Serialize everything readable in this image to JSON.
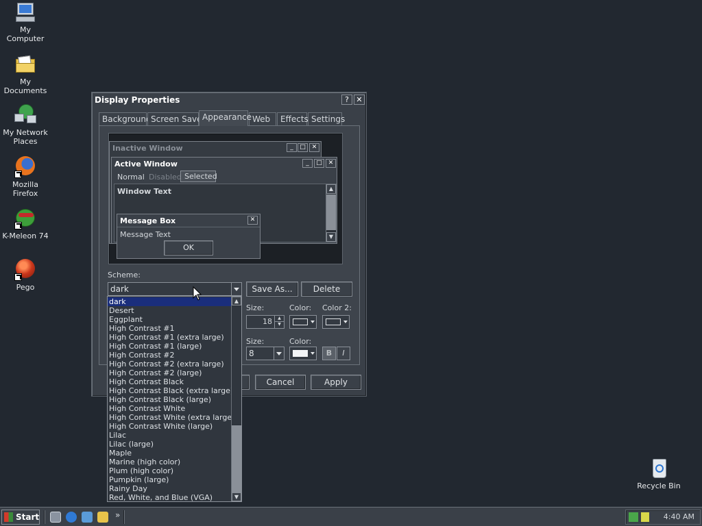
{
  "desktop": {
    "icons": [
      {
        "label": "My Computer",
        "icon": "computer-icon"
      },
      {
        "label": "My Documents",
        "icon": "folder-icon"
      },
      {
        "label": "My Network Places",
        "icon": "network-icon"
      },
      {
        "label": "Mozilla Firefox",
        "icon": "firefox-icon"
      },
      {
        "label": "K-Meleon 74",
        "icon": "k-meleon-icon"
      },
      {
        "label": "Pego",
        "icon": "pego-icon"
      },
      {
        "label": "Recycle Bin",
        "icon": "recycle-bin-icon"
      }
    ]
  },
  "window": {
    "title": "Display Properties",
    "help_label": "?",
    "close_label": "✕",
    "tabs": [
      "Background",
      "Screen Saver",
      "Appearance",
      "Web",
      "Effects",
      "Settings"
    ],
    "active_tab": "Appearance"
  },
  "preview": {
    "inactive_title": "Inactive Window",
    "active_title": "Active Window",
    "menu_normal": "Normal",
    "menu_disabled": "Disabled",
    "menu_selected": "Selected",
    "window_text": "Window Text",
    "msgbox_title": "Message Box",
    "msgbox_text": "Message Text",
    "ok_label": "OK"
  },
  "scheme": {
    "label": "Scheme:",
    "value": "dark",
    "save_as": "Save As...",
    "delete": "Delete",
    "options": [
      "dark",
      "Desert",
      "Eggplant",
      "High Contrast #1",
      "High Contrast #1 (extra large)",
      "High Contrast #1 (large)",
      "High Contrast #2",
      "High Contrast #2 (extra large)",
      "High Contrast #2 (large)",
      "High Contrast Black",
      "High Contrast Black (extra large)",
      "High Contrast Black (large)",
      "High Contrast White",
      "High Contrast White (extra large)",
      "High Contrast White (large)",
      "Lilac",
      "Lilac (large)",
      "Maple",
      "Marine (high color)",
      "Plum (high color)",
      "Pumpkin (large)",
      "Rainy Day",
      "Red, White, and Blue (VGA)"
    ]
  },
  "item_row": {
    "size_label": "Size:",
    "color_label": "Color:",
    "color2_label": "Color 2:",
    "size_value": "18"
  },
  "font_row": {
    "size_label": "Size:",
    "color_label": "Color:",
    "size_value": "8",
    "bold_label": "B",
    "italic_label": "I"
  },
  "buttons": {
    "cancel": "Cancel",
    "apply": "Apply"
  },
  "taskbar": {
    "start": "Start",
    "more": "»",
    "clock": "4:40 AM"
  }
}
